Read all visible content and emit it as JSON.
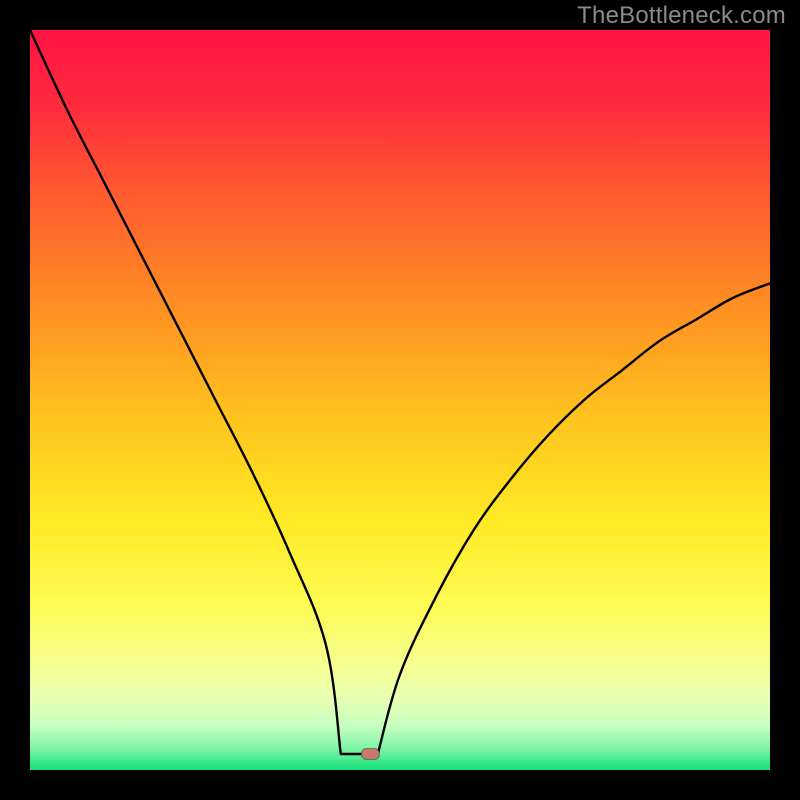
{
  "watermark": "TheBottleneck.com",
  "colors": {
    "frame": "#000000",
    "curve": "#000000",
    "marker_fill": "#c77a6b",
    "marker_stroke": "rgba(0,0,0,0.35)",
    "gradient_stops": [
      {
        "offset": 0.0,
        "color": "#ff1444"
      },
      {
        "offset": 0.1,
        "color": "#ff2a3e"
      },
      {
        "offset": 0.22,
        "color": "#ff5a2f"
      },
      {
        "offset": 0.36,
        "color": "#ff8a24"
      },
      {
        "offset": 0.52,
        "color": "#ffc21e"
      },
      {
        "offset": 0.66,
        "color": "#ffe924"
      },
      {
        "offset": 0.78,
        "color": "#fdfb55"
      },
      {
        "offset": 0.85,
        "color": "#f6ff8a"
      },
      {
        "offset": 0.9,
        "color": "#e9ffb0"
      },
      {
        "offset": 0.94,
        "color": "#c8ffc0"
      },
      {
        "offset": 0.97,
        "color": "#80f5a8"
      },
      {
        "offset": 1.0,
        "color": "#17e07a"
      }
    ]
  },
  "chart_data": {
    "type": "line",
    "title": "",
    "xlabel": "",
    "ylabel": "",
    "xlim": [
      0,
      100
    ],
    "ylim": [
      0,
      100
    ],
    "flat_region": [
      42,
      47
    ],
    "marker": {
      "x": 46,
      "y": 0
    },
    "series": [
      {
        "name": "bottleneck-curve",
        "x": [
          0,
          5,
          10,
          15,
          20,
          25,
          30,
          35,
          40,
          42,
          47,
          50,
          55,
          60,
          65,
          70,
          75,
          80,
          85,
          90,
          95,
          100
        ],
        "values": [
          100,
          89,
          79,
          69,
          59,
          49,
          39,
          28,
          15,
          0,
          0,
          11,
          22,
          31,
          38,
          44,
          49,
          53,
          57,
          60,
          63,
          65
        ]
      }
    ]
  }
}
